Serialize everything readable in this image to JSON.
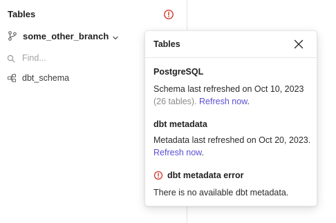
{
  "sidebar": {
    "title": "Tables",
    "branch": {
      "name": "some_other_branch"
    },
    "search": {
      "placeholder": "Find...",
      "value": ""
    },
    "schemas": [
      {
        "label": "dbt_schema"
      }
    ]
  },
  "popover": {
    "title": "Tables",
    "postgres": {
      "title": "PostgreSQL",
      "text": "Schema last refreshed on Oct 10, 2023",
      "count": "(26 tables).",
      "link": "Refresh now",
      "suffix": "."
    },
    "dbt": {
      "title": "dbt metadata",
      "text": "Metadata last refreshed on Oct 20, 2023.",
      "link": "Refresh now",
      "suffix": "."
    },
    "error": {
      "title": "dbt metadata error",
      "text": "There is no available dbt metadata."
    }
  },
  "colors": {
    "error": "#d0382b",
    "link": "#5a4fd0",
    "muted": "#8a8a8a"
  }
}
